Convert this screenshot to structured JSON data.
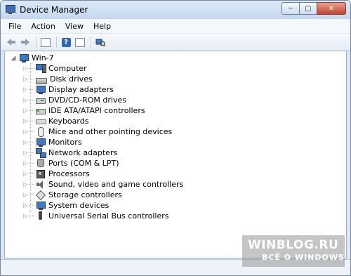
{
  "window": {
    "title": "Device Manager"
  },
  "title_buttons": {
    "minimize": "─",
    "maximize": "▢",
    "close": "✕"
  },
  "menu": [
    {
      "label": "File"
    },
    {
      "label": "Action"
    },
    {
      "label": "View"
    },
    {
      "label": "Help"
    }
  ],
  "toolbar": {
    "icons": [
      "back-arrow-icon",
      "forward-arrow-icon",
      "properties-icon",
      "help-icon",
      "show-hide-console-tree-icon",
      "scan-hardware-icon"
    ]
  },
  "tree": {
    "root": {
      "label": "Win-7",
      "expander": "◢"
    },
    "nodes": [
      {
        "label": "Computer",
        "icon": "computer-icon"
      },
      {
        "label": "Disk drives",
        "icon": "disk-drive-icon"
      },
      {
        "label": "Display adapters",
        "icon": "display-adapter-icon"
      },
      {
        "label": "DVD/CD-ROM drives",
        "icon": "dvd-drive-icon"
      },
      {
        "label": "IDE ATA/ATAPI controllers",
        "icon": "ide-controller-icon"
      },
      {
        "label": "Keyboards",
        "icon": "keyboard-icon"
      },
      {
        "label": "Mice and other pointing devices",
        "icon": "mouse-icon"
      },
      {
        "label": "Monitors",
        "icon": "monitor-icon"
      },
      {
        "label": "Network adapters",
        "icon": "network-adapter-icon"
      },
      {
        "label": "Ports (COM & LPT)",
        "icon": "port-icon"
      },
      {
        "label": "Processors",
        "icon": "processor-icon"
      },
      {
        "label": "Sound, video and game controllers",
        "icon": "sound-icon"
      },
      {
        "label": "Storage controllers",
        "icon": "storage-controller-icon"
      },
      {
        "label": "System devices",
        "icon": "system-device-icon"
      },
      {
        "label": "Universal Serial Bus controllers",
        "icon": "usb-icon"
      }
    ],
    "collapsed_expander": "▷"
  },
  "watermark": {
    "line1": "WINBLOG.RU",
    "line2": "ВСЁ О WINDOWS"
  }
}
